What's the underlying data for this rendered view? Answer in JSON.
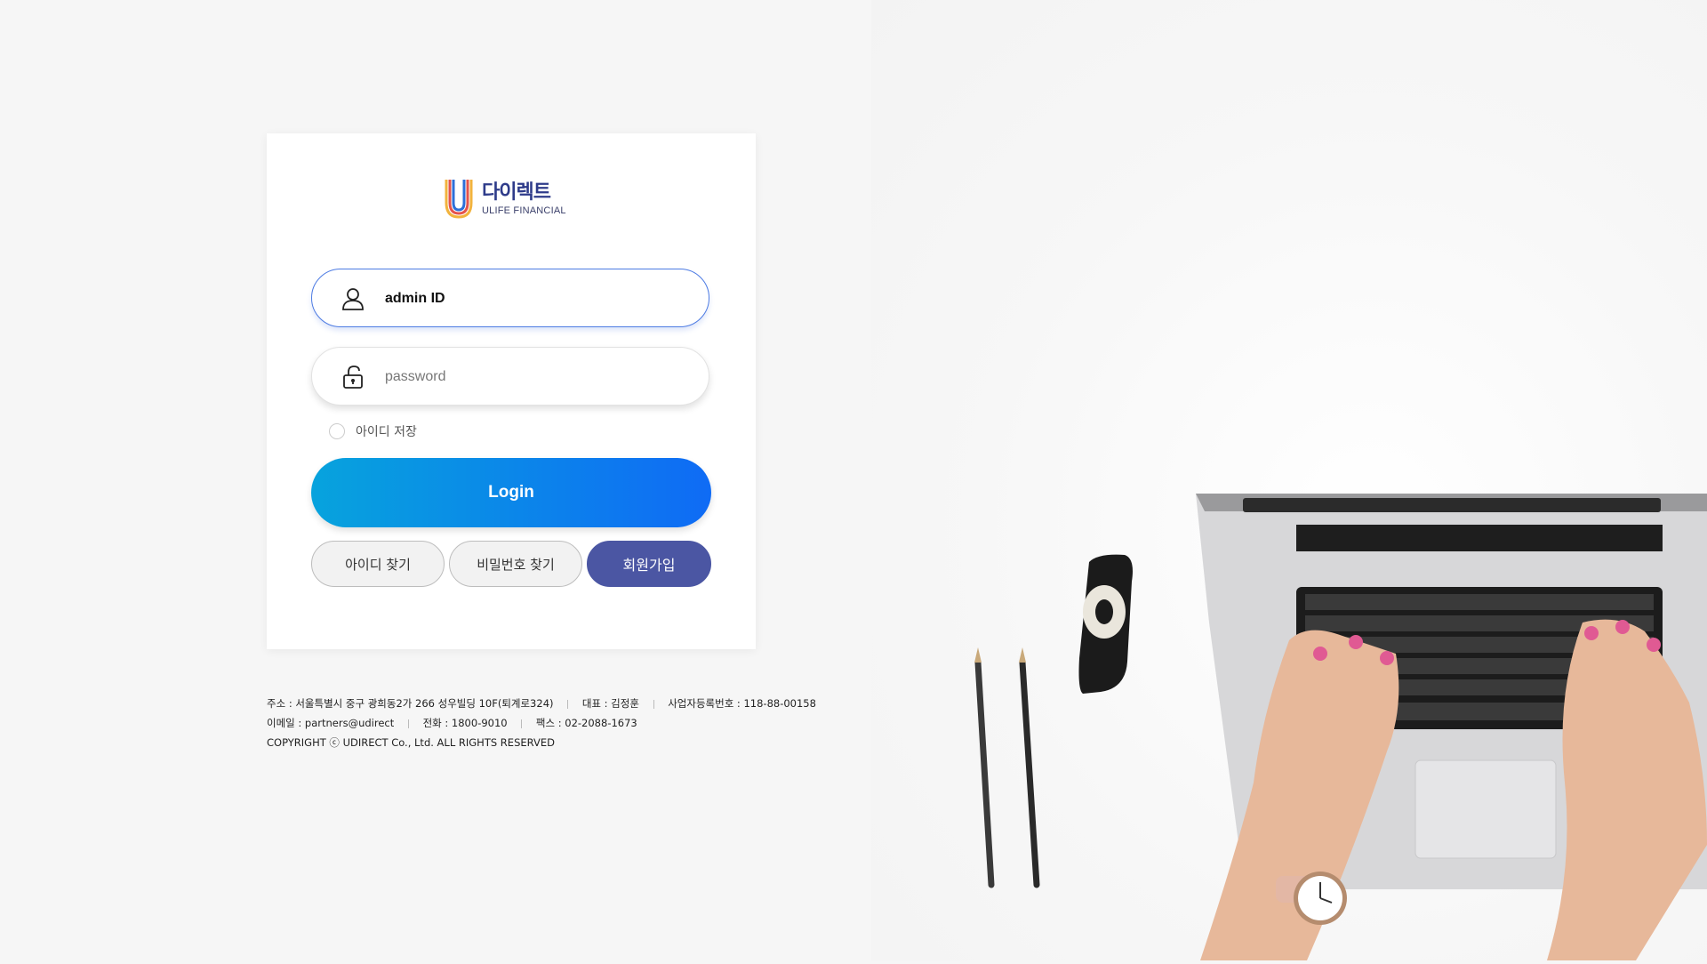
{
  "logo": {
    "name_ko": "다이렉트",
    "name_en": "ULIFE FINANCIAL"
  },
  "login_form": {
    "id_field": {
      "value": "admin ID",
      "placeholder": "admin ID"
    },
    "password_field": {
      "value": "",
      "placeholder": "password"
    },
    "remember_label": "아이디 저장",
    "remember_checked": false,
    "login_label": "Login",
    "find_id_label": "아이디 찾기",
    "find_password_label": "비밀번호 찾기",
    "signup_label": "회원가입"
  },
  "footer": {
    "address": "주소 : 서울특별시 중구 광희동2가 266 성우빌딩 10F(퇴계로324)",
    "ceo": "대표 : 김정훈",
    "biz_no": "사업자등록번호 : 118-88-00158",
    "email": "이메일 : partners@udirect",
    "phone": "전화 : 1800-9010",
    "fax": "팩스 : 02-2088-1673",
    "copyright": "COPYRIGHT ⓒ UDIRECT Co., Ltd. ALL RIGHTS RESERVED"
  },
  "colors": {
    "accent_blue": "#0f6bf5",
    "accent_cyan": "#07a3dd",
    "signup_navy": "#4b56a3",
    "brand_navy": "#2e3b8a"
  },
  "icons": {
    "id_field": "user-icon",
    "password_field": "lock-icon",
    "logo": "u-logo-icon"
  }
}
